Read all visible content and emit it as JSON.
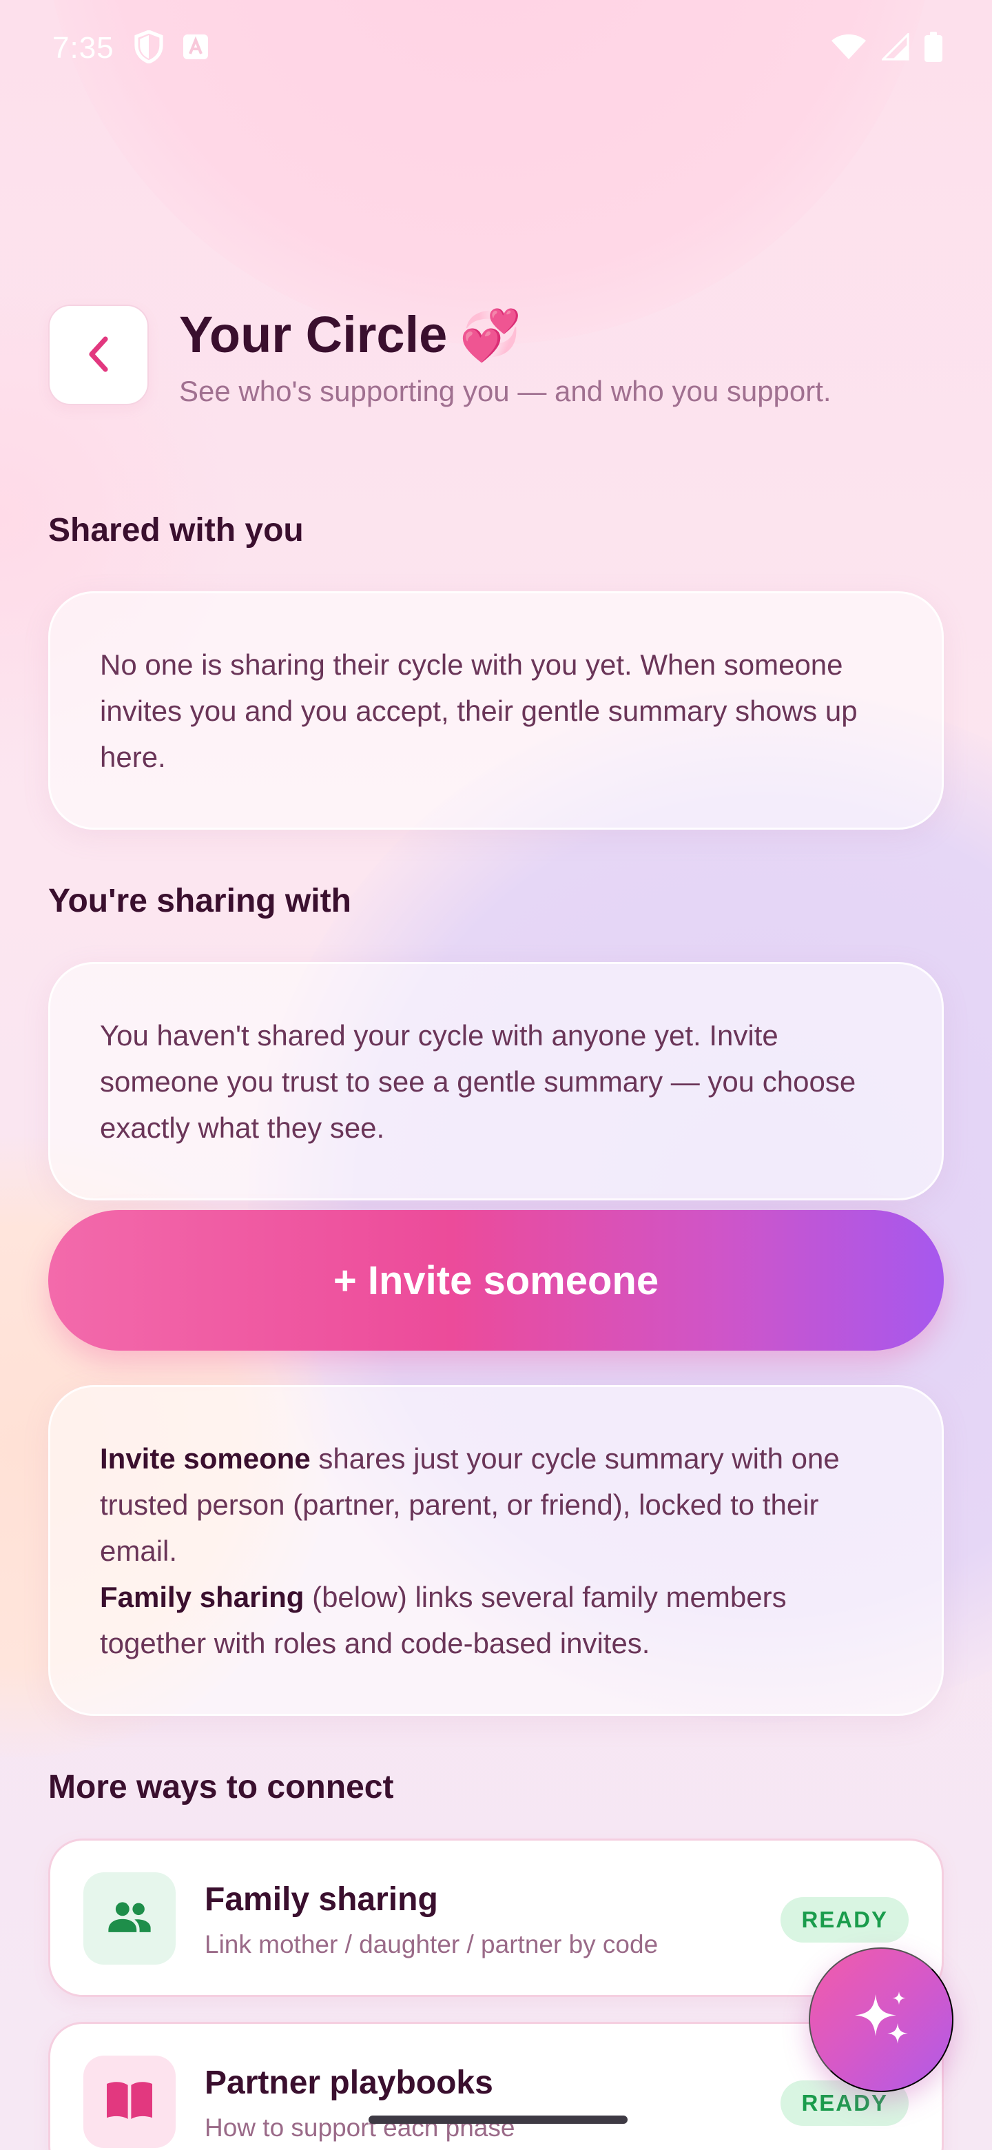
{
  "status_bar": {
    "time": "7:35",
    "icons": [
      "shield-icon",
      "text-a-icon",
      "wifi-icon",
      "cell-signal-icon",
      "battery-icon"
    ]
  },
  "header": {
    "back_icon": "chevron-left-icon",
    "title": "Your Circle",
    "title_emoji": "💞",
    "subtitle": "See who's supporting you — and who you support."
  },
  "shared_with_you": {
    "label": "Shared with you",
    "empty_text": "No one is sharing their cycle with you yet. When someone invites you and you accept, their gentle summary shows up here."
  },
  "sharing_with": {
    "label": "You're sharing with",
    "empty_text": "You haven't shared your cycle with anyone yet. Invite someone you trust to see a gentle summary — you choose exactly what they see."
  },
  "invite_button": {
    "label": "+ Invite someone"
  },
  "info_card": {
    "invite_bold": "Invite someone",
    "invite_text": " shares just your cycle summary with one trusted person (partner, parent, or friend), locked to their email.",
    "family_bold": "Family sharing",
    "family_text": " (below) links several family members together with roles and code-based invites."
  },
  "more_ways": {
    "label": "More ways to connect",
    "items": [
      {
        "title": "Family sharing",
        "description": "Link mother / daughter / partner by code",
        "badge": "READY",
        "icon": "people-icon",
        "icon_color": "#1e8e4a",
        "icon_bg": "#e6f6ec"
      },
      {
        "title": "Partner playbooks",
        "description": "How to support each phase",
        "badge": "READY",
        "icon": "book-icon",
        "icon_color": "#e2387f",
        "icon_bg": "#fde3ee"
      }
    ]
  },
  "fab": {
    "icon": "sparkle-icon"
  },
  "colors": {
    "accent_pink": "#ec4b9a",
    "accent_purple": "#a658ee",
    "title_color": "#3a0f2e",
    "badge_bg": "#d9f5e2",
    "badge_text": "#1a9c4c"
  }
}
